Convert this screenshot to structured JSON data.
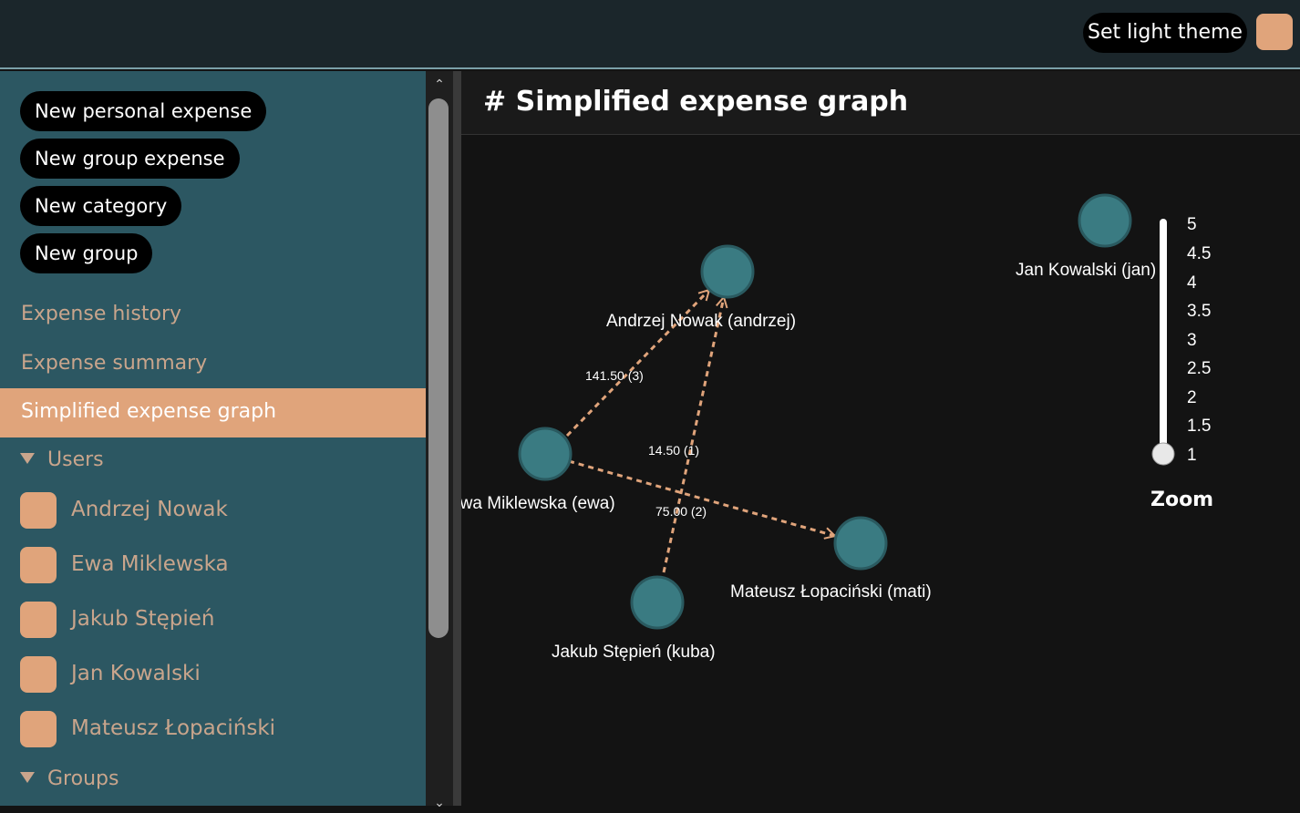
{
  "topbar": {
    "theme_button_label": "Set light theme",
    "accent_color": "#e0a47b"
  },
  "sidebar": {
    "actions": [
      "New personal expense",
      "New group expense",
      "New category",
      "New group"
    ],
    "nav": [
      "Expense history",
      "Expense summary",
      "Simplified expense graph"
    ],
    "active_nav": "Simplified expense graph",
    "users_heading": "Users",
    "users": [
      "Andrzej Nowak",
      "Ewa Miklewska",
      "Jakub Stępień",
      "Jan Kowalski",
      "Mateusz Łopaciński"
    ],
    "groups_heading": "Groups"
  },
  "main": {
    "title": "# Simplified expense graph"
  },
  "graph": {
    "nodes": [
      {
        "id": "andrzej",
        "label": "Andrzej Nowak (andrzej)"
      },
      {
        "id": "ewa",
        "label": "Ewa Miklewska (ewa)"
      },
      {
        "id": "kuba",
        "label": "Jakub Stępień (kuba)"
      },
      {
        "id": "jan",
        "label": "Jan Kowalski (jan)"
      },
      {
        "id": "mati",
        "label": "Mateusz Łopaciński (mati)"
      }
    ],
    "edges": [
      {
        "from": "ewa",
        "to": "andrzej",
        "label": "141.50 (3)"
      },
      {
        "from": "kuba",
        "to": "andrzej",
        "label": "14.50 (1)"
      },
      {
        "from": "ewa",
        "to": "mati",
        "label": "75.00 (2)"
      }
    ],
    "node_color": "#3a7b82",
    "edge_color": "#e0a47b"
  },
  "zoom": {
    "label": "Zoom",
    "ticks": [
      "5",
      "4.5",
      "4",
      "3.5",
      "3",
      "2.5",
      "2",
      "1.5",
      "1"
    ],
    "value": 1
  }
}
